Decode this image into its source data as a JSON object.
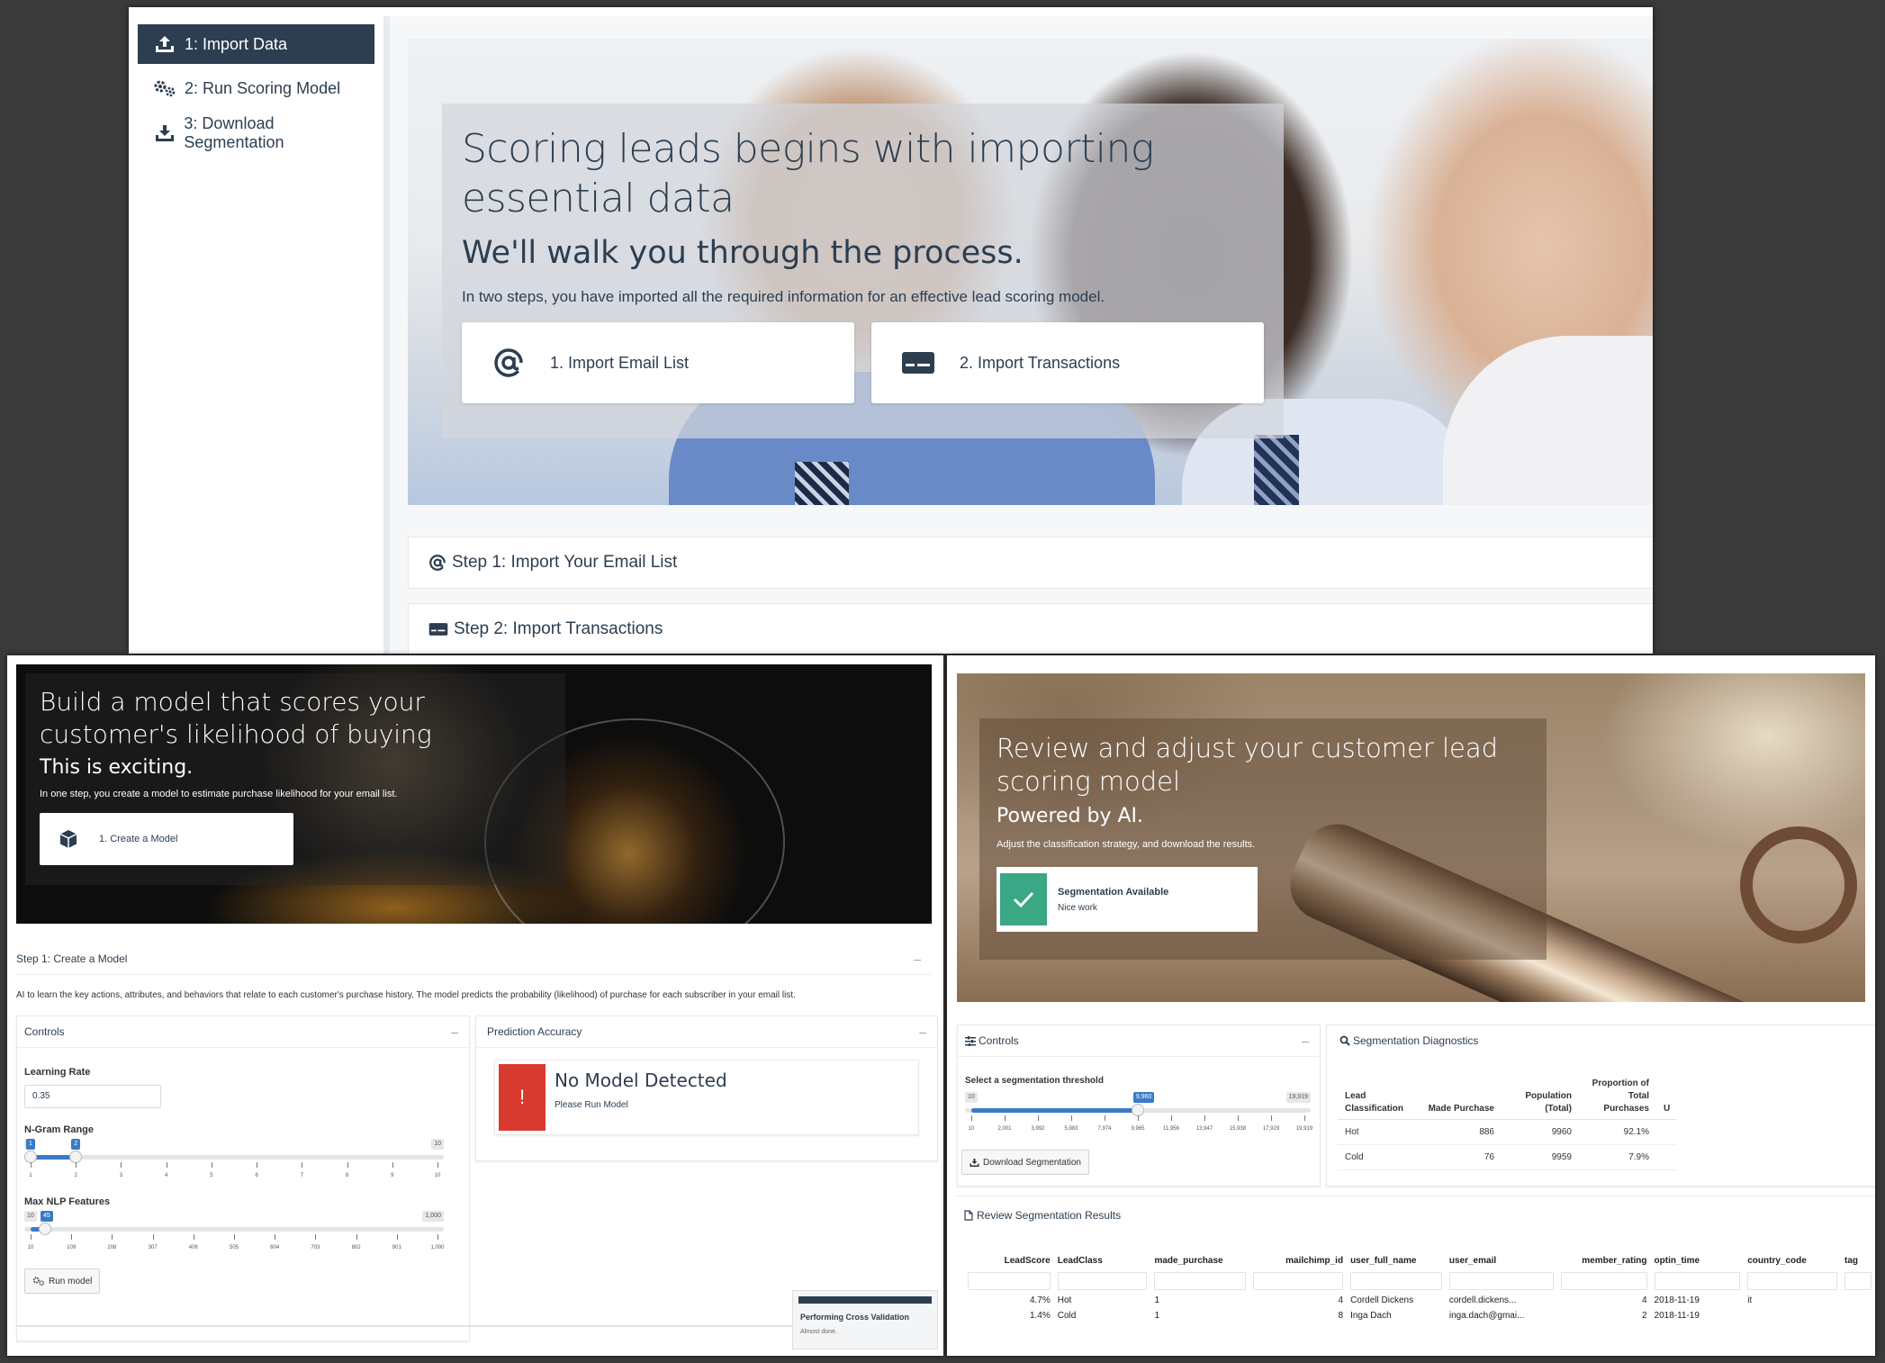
{
  "top": {
    "sidebar": {
      "items": [
        {
          "label": "1: Import Data"
        },
        {
          "label": "2: Run Scoring Model"
        },
        {
          "label": "3: Download Segmentation"
        }
      ]
    },
    "hero": {
      "title": "Scoring leads begins with importing essential data",
      "subtitle": "We'll walk you through the process.",
      "description": "In two steps, you have imported all the required information for an effective lead scoring model.",
      "buttons": [
        "1. Import Email List",
        "2. Import Transactions"
      ]
    },
    "steps": [
      "Step 1: Import Your Email List",
      "Step 2: Import Transactions"
    ]
  },
  "bottom_left": {
    "hero": {
      "title": "Build a model that scores your customer's likelihood of buying",
      "subtitle": "This is exciting.",
      "description": "In one step, you create a model to estimate purchase likelihood for your email list.",
      "button": "1. Create a Model"
    },
    "step_title": "Step 1: Create a Model",
    "step_desc": "AI to learn the key actions, attributes, and behaviors that relate to each customer's purchase history. The model predicts the probability (likelihood) of purchase for each subscriber in your email list.",
    "controls": {
      "title": "Controls",
      "learning_rate_label": "Learning Rate",
      "learning_rate_value": "0.35",
      "ngram_label": "N-Gram Range",
      "ngram": {
        "min": 1,
        "max": 10,
        "from": 1,
        "to": 2,
        "min_label": "1",
        "max_label": "10",
        "from_label": "1",
        "to_label": "2",
        "tick_labels": [
          "1",
          "2",
          "3",
          "4",
          "5",
          "6",
          "7",
          "8",
          "9",
          "10"
        ]
      },
      "nlp_label": "Max NLP Features",
      "nlp": {
        "min": 10,
        "max": 1000,
        "value": 45,
        "min_label": "10",
        "max_label": "1,000",
        "value_label": "45",
        "tick_labels": [
          "10",
          "109",
          "208",
          "307",
          "406",
          "505",
          "604",
          "703",
          "802",
          "901",
          "1,000"
        ]
      },
      "run_button": "Run model",
      "minimize": "–"
    },
    "accuracy": {
      "title": "Prediction Accuracy",
      "status_title": "No Model Detected",
      "status_sub": "Please Run Model",
      "icon_glyph": "!",
      "minimize": "–"
    },
    "notification": {
      "title": "Performing Cross Validation",
      "sub": "Almost done."
    }
  },
  "bottom_right": {
    "hero": {
      "title": "Review and adjust your customer lead scoring model",
      "subtitle": "Powered by AI.",
      "description": "Adjust the classification strategy, and download the results.",
      "card_title": "Segmentation Available",
      "card_sub": "Nice work"
    },
    "controls": {
      "title": "Controls",
      "minimize": "–",
      "threshold_label": "Select a segmentation threshold",
      "slider": {
        "min": 10,
        "max": 19919,
        "value": 9960,
        "min_label": "10",
        "max_label": "19,919",
        "value_label": "9,960",
        "tick_labels": [
          "10",
          "2,001",
          "3,992",
          "5,983",
          "7,974",
          "9,965",
          "11,956",
          "13,947",
          "15,938",
          "17,929",
          "19,919"
        ]
      },
      "download_button": "Download Segmentation"
    },
    "diagnostics": {
      "title": "Segmentation Diagnostics",
      "headers": [
        "Lead Classification",
        "Made Purchase",
        "Population (Total)",
        "Proportion of Total Purchases",
        "U"
      ],
      "rows": [
        [
          "Hot",
          "886",
          "9960",
          "92.1%"
        ],
        [
          "Cold",
          "76",
          "9959",
          "7.9%"
        ]
      ]
    },
    "results": {
      "title": "Review Segmentation Results",
      "headers": [
        "LeadScore",
        "LeadClass",
        "made_purchase",
        "mailchimp_id",
        "user_full_name",
        "user_email",
        "member_rating",
        "optin_time",
        "country_code",
        "tag"
      ],
      "rows": [
        [
          "4.7%",
          "Hot",
          "1",
          "4",
          "Cordell Dickens",
          "cordell.dickens...",
          "4",
          "2018-11-19",
          "it",
          ""
        ],
        [
          "1.4%",
          "Cold",
          "1",
          "8",
          "Inga Dach",
          "inga.dach@gmai...",
          "2",
          "2018-11-19",
          "",
          ""
        ]
      ]
    }
  },
  "colors": {
    "navy": "#2c3e50",
    "slider_blue": "#3a7bc8",
    "danger": "#d93a2f",
    "success": "#3aa785"
  }
}
